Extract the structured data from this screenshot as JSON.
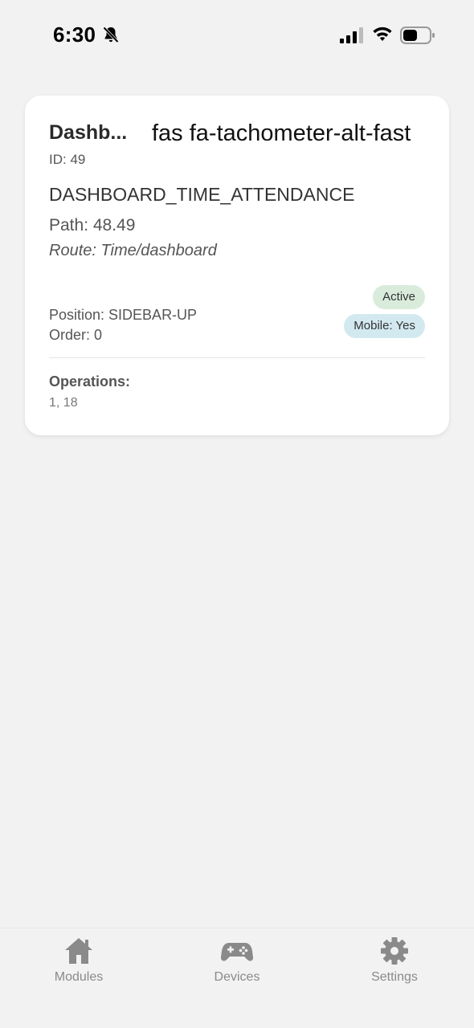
{
  "status_bar": {
    "time": "6:30",
    "icons": [
      "bell-slash-icon",
      "cellular-signal-icon",
      "wifi-icon",
      "battery-icon"
    ]
  },
  "card": {
    "name": "Dashb...",
    "icon_class": "fas fa-tachometer-alt-fast",
    "id_text": "ID: 49",
    "key": "DASHBOARD_TIME_ATTENDANCE",
    "path_text": "Path: 48.49",
    "route_text": "Route: Time/dashboard",
    "position_text": "Position: SIDEBAR-UP",
    "order_text": "Order: 0",
    "badges": {
      "active": "Active",
      "mobile": "Mobile: Yes"
    },
    "operations_label": "Operations:",
    "operations_values": "1, 18"
  },
  "tab_bar": {
    "tabs": [
      {
        "label": "Modules",
        "icon": "home-icon"
      },
      {
        "label": "Devices",
        "icon": "gamepad-icon"
      },
      {
        "label": "Settings",
        "icon": "gear-icon"
      }
    ]
  },
  "colors": {
    "background": "#f2f2f2",
    "card": "#ffffff",
    "badge_active": "#d9ecdc",
    "badge_mobile": "#d3e9f0",
    "tab_inactive": "#8a8a8a"
  }
}
